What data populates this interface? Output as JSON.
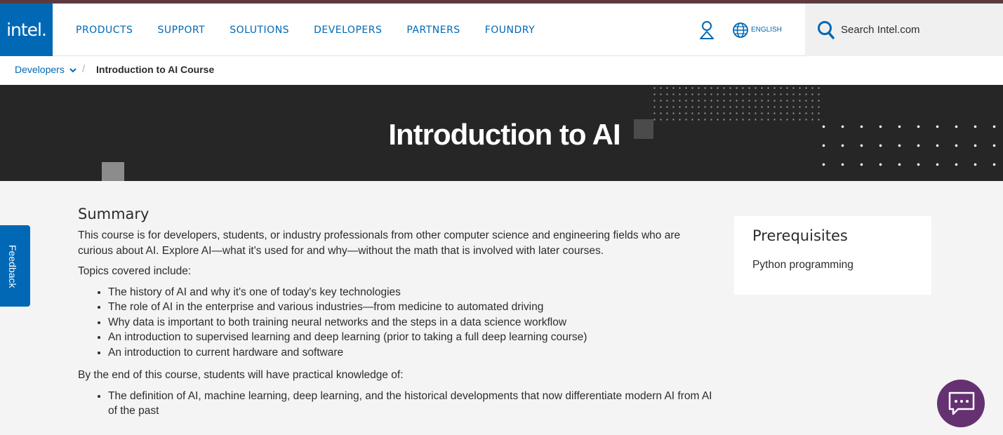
{
  "brand": {
    "logo_text": "intel."
  },
  "nav": {
    "links": [
      "PRODUCTS",
      "SUPPORT",
      "SOLUTIONS",
      "DEVELOPERS",
      "PARTNERS",
      "FOUNDRY"
    ],
    "language_label": "ENGLISH",
    "search_placeholder": "Search Intel.com"
  },
  "breadcrumb": {
    "parent": "Developers",
    "separator": "/",
    "current": "Introduction to AI Course"
  },
  "hero": {
    "title": "Introduction to AI"
  },
  "feedback": {
    "label": "Feedback"
  },
  "summary": {
    "heading": "Summary",
    "intro": "This course is for developers, students, or industry professionals from other computer science and engineering fields who are curious about AI. Explore AI—what it's used for and why—without the math that is involved with later courses.",
    "topics_heading": "Topics covered include:",
    "topics": [
      "The history of AI and why it's one of today's key technologies",
      "The role of AI in the enterprise and various industries—from medicine to automated driving",
      "Why data is important to both training neural networks and the steps in a data science workflow",
      "An introduction to supervised learning and deep learning (prior to taking a full deep learning course)",
      "An introduction to current hardware and software"
    ],
    "outcomes_heading": "By the end of this course, students will have practical knowledge of:",
    "outcomes": [
      "The definition of AI, machine learning, deep learning, and the historical developments that now differentiate modern AI from AI of the past"
    ]
  },
  "prerequisites": {
    "heading": "Prerequisites",
    "items": [
      "Python programming"
    ]
  },
  "icons": {
    "account": "user-icon",
    "language": "globe-icon",
    "search": "search-icon",
    "breadcrumb_toggle": "chevron-down-icon",
    "chat": "chat-icon"
  },
  "colors": {
    "brand_blue": "#0068b5",
    "hero_bg": "#262626",
    "chat_purple": "#653171",
    "page_bg": "#f4f4f4"
  }
}
